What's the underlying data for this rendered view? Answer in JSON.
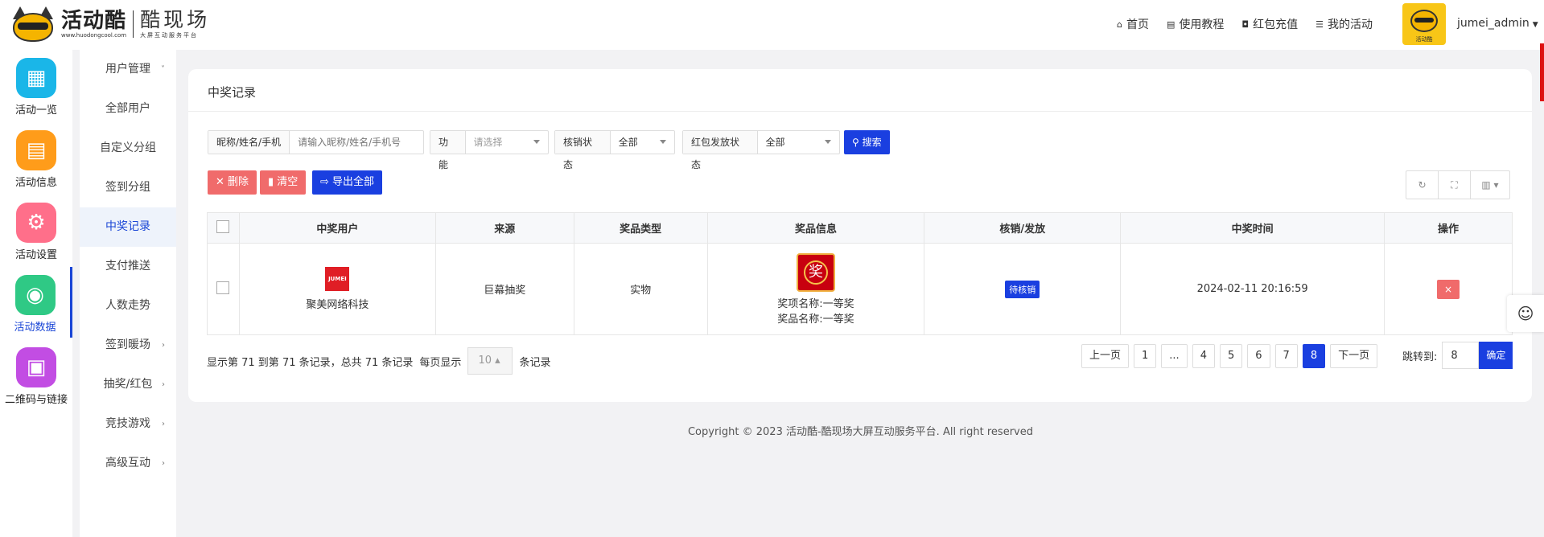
{
  "brand": {
    "name_cn": "活动酷",
    "site": "www.huodongcool.com",
    "product": "酷现场",
    "slogan": "大屏互动服务平台"
  },
  "topnav": [
    {
      "icon": "home-icon",
      "glyph": "⌂",
      "label": "首页"
    },
    {
      "icon": "book-icon",
      "glyph": "▤",
      "label": "使用教程"
    },
    {
      "icon": "wallet-icon",
      "glyph": "◘",
      "label": "红包充值"
    },
    {
      "icon": "list-icon",
      "glyph": "☰",
      "label": "我的活动"
    }
  ],
  "user": {
    "avatar_text": "活动酷",
    "name": "jumei_admin"
  },
  "sidebar1": [
    {
      "label": "活动一览",
      "color": "#1ab6e8",
      "glyph": "▦"
    },
    {
      "label": "活动信息",
      "color": "#ff9c1a",
      "glyph": "▤"
    },
    {
      "label": "活动设置",
      "color": "#ff6f8a",
      "glyph": "⚙"
    },
    {
      "label": "活动数据",
      "color": "#2fc985",
      "glyph": "◉",
      "active": true
    },
    {
      "label": "二维码与链接",
      "color": "#c24de3",
      "glyph": "▣"
    }
  ],
  "sidebar2": [
    {
      "label": "用户管理",
      "arrow": "˅"
    },
    {
      "label": "全部用户",
      "arrow": ""
    },
    {
      "label": "自定义分组",
      "arrow": ""
    },
    {
      "label": "签到分组",
      "arrow": ""
    },
    {
      "label": "中奖记录",
      "arrow": "",
      "active": true
    },
    {
      "label": "支付推送",
      "arrow": ""
    },
    {
      "label": "人数走势",
      "arrow": ""
    },
    {
      "label": "签到暖场",
      "arrow": "›"
    },
    {
      "label": "抽奖/红包",
      "arrow": "›"
    },
    {
      "label": "竞技游戏",
      "arrow": "›"
    },
    {
      "label": "高级互动",
      "arrow": "›"
    }
  ],
  "card": {
    "title": "中奖记录"
  },
  "filters": {
    "nickname_label": "昵称/姓名/手机",
    "nickname_placeholder": "请输入昵称/姓名/手机号",
    "feature_label": "功能",
    "feature_value": "请选择",
    "verify_label": "核销状态",
    "verify_value": "全部",
    "redpack_label": "红包发放状态",
    "redpack_value": "全部",
    "search_label": "搜索"
  },
  "actions": {
    "delete": "删除",
    "clear": "清空",
    "export": "导出全部"
  },
  "table": {
    "headers": [
      "中奖用户",
      "来源",
      "奖品类型",
      "奖品信息",
      "核销/发放",
      "中奖时间",
      "操作"
    ],
    "rows": [
      {
        "user_logo": "JUMEI",
        "user": "聚美网络科技",
        "source": "巨幕抽奖",
        "prize_type": "实物",
        "prize_glyph": "奖",
        "prize_item": "奖项名称:一等奖",
        "prize_name": "奖品名称:一等奖",
        "status": "待核销",
        "time": "2024-02-11 20:16:59",
        "op": "×"
      }
    ]
  },
  "pagination": {
    "info": "显示第 71 到第 71 条记录，总共 71 条记录",
    "per_page_label": "每页显示",
    "per_page": "10",
    "per_page_suffix": "条记录",
    "prev": "上一页",
    "pages": [
      "1",
      "...",
      "4",
      "5",
      "6",
      "7",
      "8"
    ],
    "current": "8",
    "next": "下一页",
    "jump_label": "跳转到:",
    "jump_value": "8",
    "confirm": "确定"
  },
  "footer": "Copyright © 2023 活动酷-酷现场大屏互动服务平台. All right reserved"
}
